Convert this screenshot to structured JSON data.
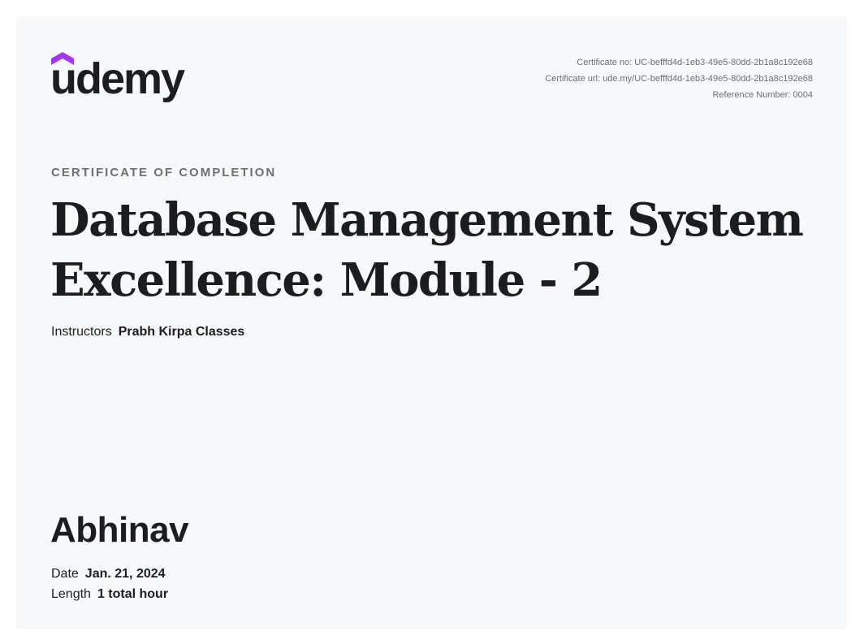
{
  "brand": {
    "name": "udemy",
    "accent_color": "#a435f0",
    "text_color": "#1c1d1f"
  },
  "meta": {
    "certificate_no": "Certificate no: UC-befffd4d-1eb3-49e5-80dd-2b1a8c192e68",
    "certificate_url": "Certificate url: ude.my/UC-befffd4d-1eb3-49e5-80dd-2b1a8c192e68",
    "reference_number": "Reference Number: 0004"
  },
  "certificate": {
    "label": "CERTIFICATE OF COMPLETION",
    "course_title_line1": "Database Management System",
    "course_title_line2": "Excellence: Module - 2",
    "instructors_label": "Instructors",
    "instructors_value": "Prabh Kirpa Classes",
    "student_name": "Abhinav",
    "date_label": "Date",
    "date_value": "Jan. 21, 2024",
    "length_label": "Length",
    "length_value": "1 total hour"
  }
}
